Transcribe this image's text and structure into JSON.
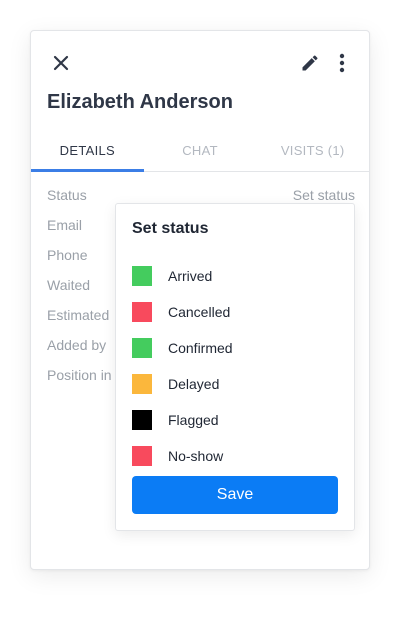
{
  "contact": {
    "name": "Elizabeth Anderson"
  },
  "tabs": [
    {
      "label": "DETAILS",
      "active": true
    },
    {
      "label": "CHAT",
      "active": false
    },
    {
      "label": "VISITS (1)",
      "active": false
    }
  ],
  "details": {
    "status_label": "Status",
    "status_value": "Set status",
    "email_label": "Email",
    "phone_label": "Phone",
    "waited_label": "Waited",
    "estimated_label": "Estimated",
    "added_by_label": "Added by",
    "position_label": "Position in"
  },
  "set_status": {
    "title": "Set status",
    "options": [
      {
        "label": "Arrived",
        "color": "#44cc5e"
      },
      {
        "label": "Cancelled",
        "color": "#f84a5d"
      },
      {
        "label": "Confirmed",
        "color": "#44cc5e"
      },
      {
        "label": "Delayed",
        "color": "#fbb73c"
      },
      {
        "label": "Flagged",
        "color": "#000000"
      },
      {
        "label": "No-show",
        "color": "#f84a5d"
      }
    ],
    "save_label": "Save"
  },
  "icons": {
    "close": "close-icon",
    "edit": "pencil-icon",
    "more": "more-vertical-icon"
  },
  "colors": {
    "accent": "#0b7cf5",
    "tab_indicator": "#3b7ee6"
  }
}
